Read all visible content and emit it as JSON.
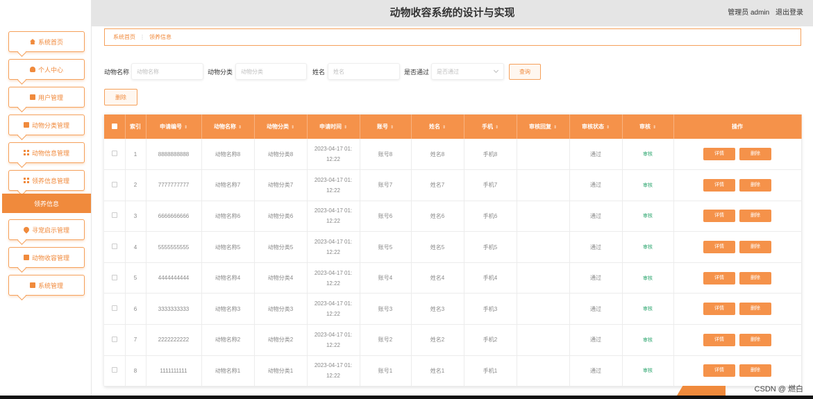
{
  "header": {
    "title": "动物收容系统的设计与实现",
    "user": "管理员 admin",
    "logout": "退出登录"
  },
  "sidebar": {
    "items": [
      {
        "label": "系统首页",
        "icon": "home-icon"
      },
      {
        "label": "个人中心",
        "icon": "user-icon"
      },
      {
        "label": "用户管理",
        "icon": "folder-icon"
      },
      {
        "label": "动物分类管理",
        "icon": "book-icon"
      },
      {
        "label": "动物信息管理",
        "icon": "grid-icon"
      },
      {
        "label": "领养信息管理",
        "icon": "grid-icon"
      },
      {
        "label": "寻宠启示管理",
        "icon": "pin-icon"
      },
      {
        "label": "动物收容管理",
        "icon": "camera-icon"
      },
      {
        "label": "系统管理",
        "icon": "box-icon"
      }
    ],
    "active": "领养信息"
  },
  "breadcrumb": {
    "home": "系统首页",
    "separator": "⋮",
    "current": "领养信息"
  },
  "search": {
    "animal_name_label": "动物名称",
    "animal_name_placeholder": "动物名称",
    "animal_type_label": "动物分类",
    "animal_type_placeholder": "动物分类",
    "name_label": "姓名",
    "name_placeholder": "姓名",
    "approved_label": "是否通过",
    "approved_placeholder": "是否通过",
    "query_button": "查询"
  },
  "toolbar": {
    "delete_button": "删除"
  },
  "table": {
    "headers": [
      "索引",
      "申请编号",
      "动物名称",
      "动物分类",
      "申请时间",
      "账号",
      "姓名",
      "手机",
      "审核回复",
      "审核状态",
      "审核",
      "操作"
    ],
    "sort_glyph": "⇕",
    "audit_label": "审核",
    "detail_button": "详情",
    "delete_button": "删除",
    "rows": [
      {
        "idx": "1",
        "app_no": "8888888888",
        "animal_name": "动物名称8",
        "animal_type": "动物分类8",
        "time1": "2023-04-17 01:",
        "time2": "12:22",
        "account": "账号8",
        "name": "姓名8",
        "phone": "手机8",
        "reply": "",
        "status": "通过"
      },
      {
        "idx": "2",
        "app_no": "7777777777",
        "animal_name": "动物名称7",
        "animal_type": "动物分类7",
        "time1": "2023-04-17 01:",
        "time2": "12:22",
        "account": "账号7",
        "name": "姓名7",
        "phone": "手机7",
        "reply": "",
        "status": "通过"
      },
      {
        "idx": "3",
        "app_no": "6666666666",
        "animal_name": "动物名称6",
        "animal_type": "动物分类6",
        "time1": "2023-04-17 01:",
        "time2": "12:22",
        "account": "账号6",
        "name": "姓名6",
        "phone": "手机6",
        "reply": "",
        "status": "通过"
      },
      {
        "idx": "4",
        "app_no": "5555555555",
        "animal_name": "动物名称5",
        "animal_type": "动物分类5",
        "time1": "2023-04-17 01:",
        "time2": "12:22",
        "account": "账号5",
        "name": "姓名5",
        "phone": "手机5",
        "reply": "",
        "status": "通过"
      },
      {
        "idx": "5",
        "app_no": "4444444444",
        "animal_name": "动物名称4",
        "animal_type": "动物分类4",
        "time1": "2023-04-17 01:",
        "time2": "12:22",
        "account": "账号4",
        "name": "姓名4",
        "phone": "手机4",
        "reply": "",
        "status": "通过"
      },
      {
        "idx": "6",
        "app_no": "3333333333",
        "animal_name": "动物名称3",
        "animal_type": "动物分类3",
        "time1": "2023-04-17 01:",
        "time2": "12:22",
        "account": "账号3",
        "name": "姓名3",
        "phone": "手机3",
        "reply": "",
        "status": "通过"
      },
      {
        "idx": "7",
        "app_no": "2222222222",
        "animal_name": "动物名称2",
        "animal_type": "动物分类2",
        "time1": "2023-04-17 01:",
        "time2": "12:22",
        "account": "账号2",
        "name": "姓名2",
        "phone": "手机2",
        "reply": "",
        "status": "通过"
      },
      {
        "idx": "8",
        "app_no": "1111111111",
        "animal_name": "动物名称1",
        "animal_type": "动物分类1",
        "time1": "2023-04-17 01:",
        "time2": "12:22",
        "account": "账号1",
        "name": "姓名1",
        "phone": "手机1",
        "reply": "",
        "status": "通过"
      }
    ]
  },
  "watermark": "CSDN @ 燃白",
  "colors": {
    "accent": "#f08a3c",
    "header_bg": "#e5e5e5",
    "table_header": "#f5924a",
    "audit_green": "#2aa56d"
  }
}
